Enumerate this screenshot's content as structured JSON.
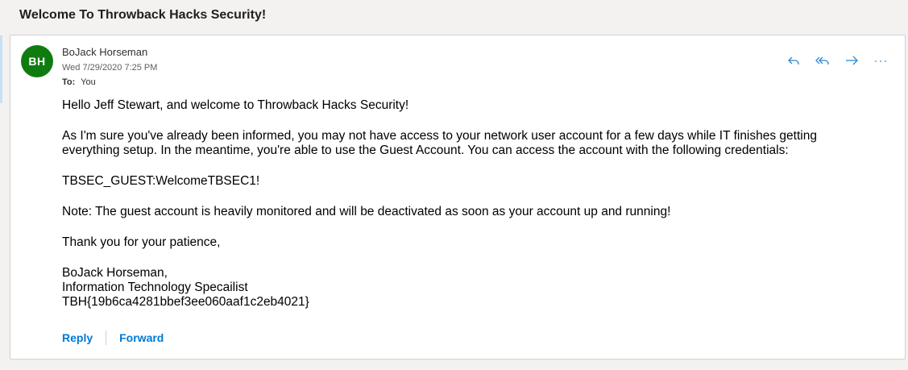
{
  "email": {
    "subject": "Welcome To Throwback Hacks Security!",
    "sender": {
      "initials": "BH",
      "name": "BoJack Horseman",
      "avatar_color": "#107c10"
    },
    "date": "Wed 7/29/2020 7:25 PM",
    "to_label": "To:",
    "to_value": "You",
    "actions": [
      {
        "name": "reply-icon"
      },
      {
        "name": "reply-all-icon"
      },
      {
        "name": "forward-icon"
      },
      {
        "name": "more-icon"
      }
    ],
    "body": {
      "greeting": "Hello Jeff Stewart, and welcome to Throwback Hacks Security!",
      "paragraph1": "As I'm sure you've already been informed, you may not have access to your network user account for a few days while IT finishes getting everything setup. In the meantime, you're able to use the Guest Account. You can access the account with the following credentials:",
      "credentials": "TBSEC_GUEST:WelcomeTBSEC1!",
      "note": "Note: The guest account is heavily monitored and will be deactivated as soon as your account up and running!",
      "thanks": "Thank you for your patience,",
      "signature_name": "BoJack Horseman,",
      "signature_title": "Information Technology Specailist",
      "signature_flag": "TBH{19b6ca4281bbef3ee060aaf1c2eb4021}"
    },
    "footer": {
      "reply_label": "Reply",
      "forward_label": "Forward"
    }
  },
  "colors": {
    "accent": "#0078d4",
    "icon": "#2b88d8"
  }
}
